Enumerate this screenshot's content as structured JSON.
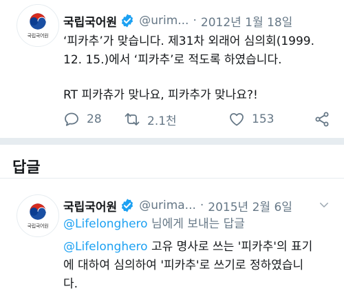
{
  "colors": {
    "accent": "#1da1f2",
    "muted": "#657786",
    "divider": "#e6ecf0"
  },
  "tweet1": {
    "display_name": "국립국어원",
    "handle": "@urim...",
    "separator": "·",
    "date": "2012년 1월 18일",
    "avatar_caption": "국립국어원",
    "line1": "‘피카추’가 맞습니다. 제31차 외래어 심의회(1999.",
    "line2": "12. 15.)에서 ‘피카추’로 적도록 하였습니다.",
    "line3": "RT  피카츄가 맞나요, 피카추가 맞나요?!",
    "stats": {
      "replies": "28",
      "retweets": "2.1천",
      "likes": "153"
    }
  },
  "replies_heading": "답글",
  "tweet2": {
    "display_name": "국립국어원",
    "handle": "@urima...",
    "separator": "·",
    "date": "2015년 2월 6일",
    "avatar_caption": "국립국어원",
    "replying_to_mention": "@Lifelonghero",
    "replying_to_suffix": " 님에게 보내는 답글",
    "body_mention": "@Lifelonghero",
    "body_line1": " 고유 명사로 쓰는 '피카추'의 표기",
    "body_line2": "에 대하여 심의하여 '피카추'로 쓰기로 정하였습니",
    "body_line3": "다."
  },
  "icons": [
    "verified-badge-icon",
    "chevron-down-icon",
    "reply-icon",
    "retweet-icon",
    "like-icon",
    "share-icon",
    "government-emblem-icon"
  ]
}
